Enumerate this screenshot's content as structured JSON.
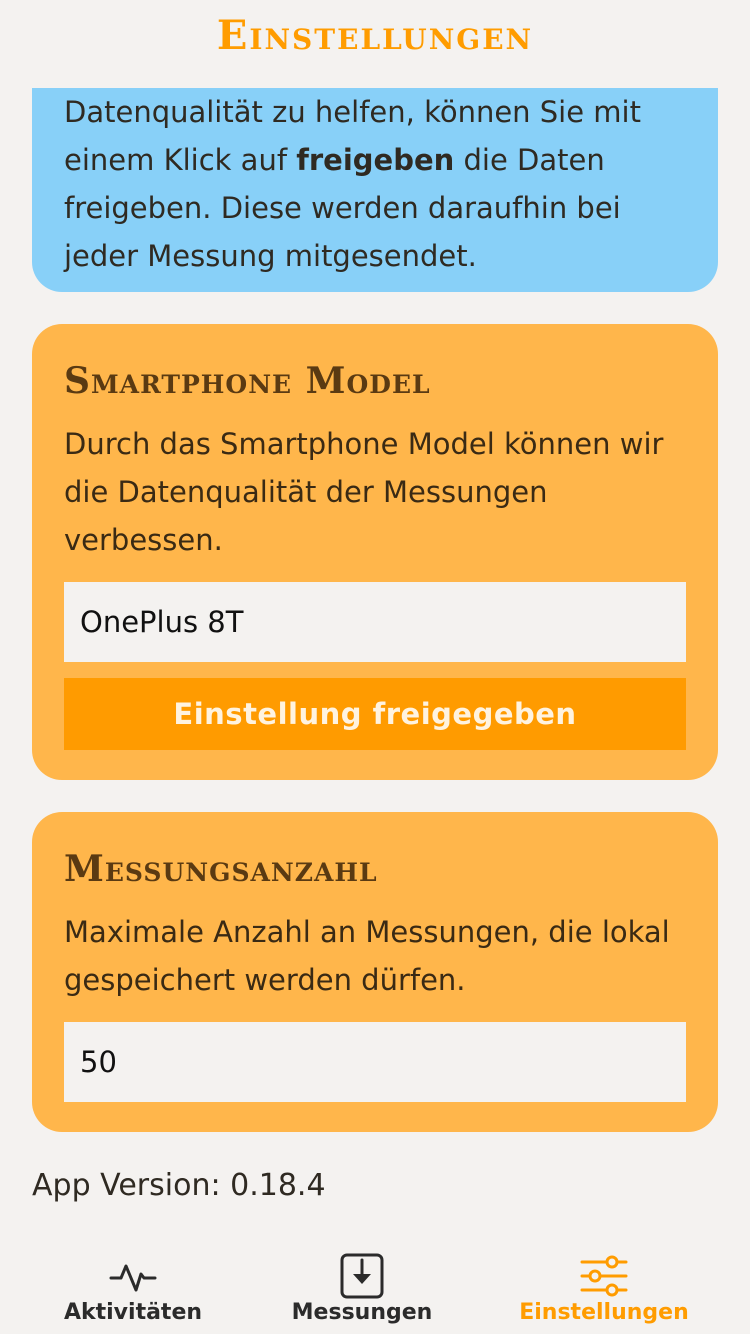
{
  "header": {
    "title": "Einstellungen"
  },
  "info_card": {
    "line1": "Datenqualität zu helfen, können Sie mit",
    "line2_pre": "einem Klick auf ",
    "line2_bold": "freigeben",
    "line2_post": " die Daten",
    "line3": "freigeben. Diese werden daraufhin bei",
    "line4": "jeder Messung mitgesendet.",
    "background_color": "#88d0f8"
  },
  "model_card": {
    "heading": "Smartphone Model",
    "description": "Durch das Smartphone Model können wir die Datenqualität der Messungen verbessen.",
    "input_value": "OnePlus 8T",
    "button_label": "Einstellung freigegeben",
    "background_color": "#ffb64b",
    "button_color": "#ff9b00"
  },
  "count_card": {
    "heading": "Messungsanzahl",
    "description": "Maximale Anzahl an Messungen, die lokal gespeichert werden dürfen.",
    "input_value": "50",
    "background_color": "#ffb64b"
  },
  "footer": {
    "app_version": "App Version: 0.18.4"
  },
  "bottom_nav": {
    "items": [
      {
        "label": "Aktivitäten",
        "icon": "activity-icon",
        "active": false
      },
      {
        "label": "Messungen",
        "icon": "download-box-icon",
        "active": false
      },
      {
        "label": "Einstellungen",
        "icon": "sliders-icon",
        "active": true
      }
    ],
    "active_color": "#ff9c00"
  }
}
